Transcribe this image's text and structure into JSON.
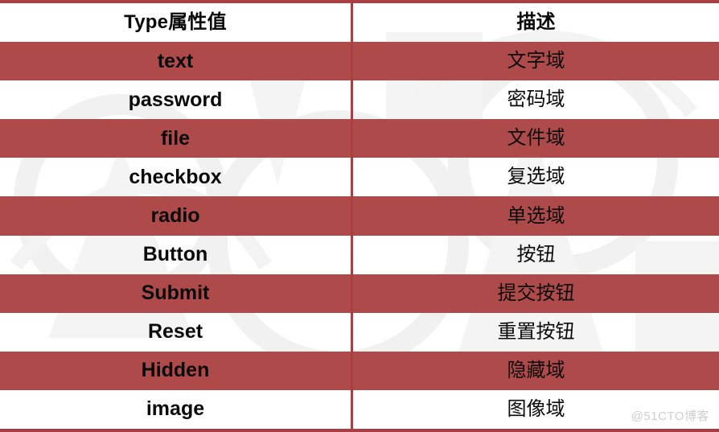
{
  "colors": {
    "band_red": "#AF4A4A",
    "rule_red": "#A83F42",
    "text": "#0a0a0a",
    "watermark": "#cfcfcf",
    "page_background": "#ffffff"
  },
  "table": {
    "columns": [
      {
        "key": "type",
        "header": "Type属性值"
      },
      {
        "key": "desc",
        "header": "描述"
      }
    ],
    "rows": [
      {
        "type": "text",
        "desc": "文字域",
        "band": "red"
      },
      {
        "type": "password",
        "desc": "密码域",
        "band": "white"
      },
      {
        "type": "file",
        "desc": "文件域",
        "band": "red"
      },
      {
        "type": "checkbox",
        "desc": "复选域",
        "band": "white"
      },
      {
        "type": "radio",
        "desc": "单选域",
        "band": "red"
      },
      {
        "type": "Button",
        "desc": "按钮",
        "band": "white"
      },
      {
        "type": "Submit",
        "desc": "提交按钮",
        "band": "red"
      },
      {
        "type": "Reset",
        "desc": "重置按钮",
        "band": "white"
      },
      {
        "type": "Hidden",
        "desc": "隐藏域",
        "band": "red"
      },
      {
        "type": "image",
        "desc": "图像域",
        "band": "white"
      }
    ]
  },
  "watermark": {
    "label": "@51CTO博客"
  }
}
